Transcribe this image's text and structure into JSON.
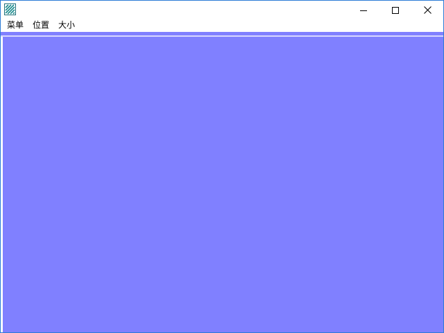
{
  "window": {
    "icon": "app-striped-logo-icon",
    "client_color": "#8080ff",
    "border_color": "#2b7bd6"
  },
  "titlebar": {
    "minimize_icon": "minimize-icon",
    "maximize_icon": "maximize-icon",
    "close_icon": "close-icon"
  },
  "menu": {
    "items": [
      {
        "label": "菜单"
      },
      {
        "label": "位置"
      },
      {
        "label": "大小"
      }
    ]
  }
}
